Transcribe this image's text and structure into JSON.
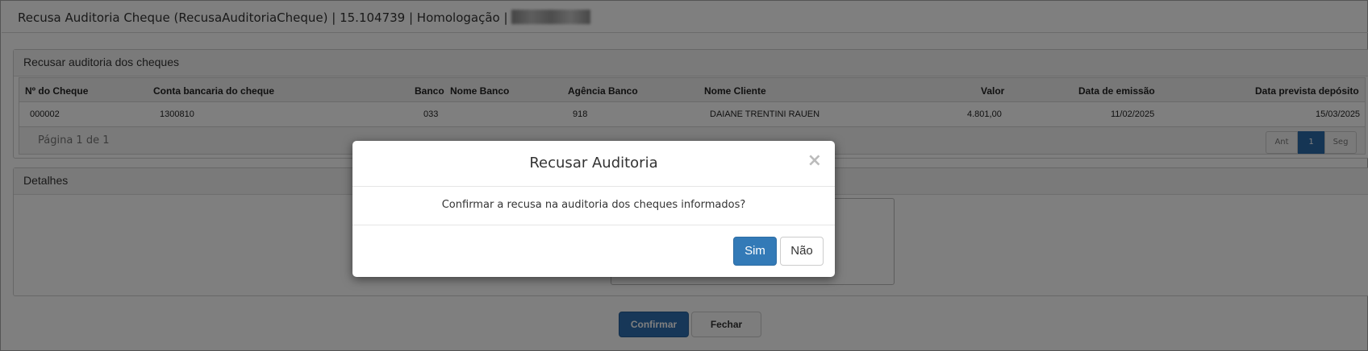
{
  "page": {
    "title": "Recusa Auditoria Cheque (RecusaAuditoriaCheque) | 15.104739 | Homologação |"
  },
  "panel_cheques": {
    "heading": "Recusar auditoria dos cheques",
    "columns": [
      "Nº do Cheque",
      "Conta bancaria do cheque",
      "Banco",
      "Nome Banco",
      "Agência Banco",
      "Nome Cliente",
      "Valor",
      "Data de emissão",
      "Data prevista depósito"
    ],
    "rows": [
      [
        "000002",
        "1300810",
        "033",
        "",
        "918",
        "DAIANE TRENTINI RAUEN",
        "4.801,00",
        "11/02/2025",
        "15/03/2025"
      ]
    ],
    "pager": {
      "info": "Página 1 de 1",
      "prev": "Ant",
      "current": "1",
      "next": "Seg"
    }
  },
  "panel_detalhes": {
    "heading": "Detalhes"
  },
  "footer": {
    "confirm_label": "Confirmar",
    "close_label": "Fechar"
  },
  "modal": {
    "title": "Recusar Auditoria",
    "close_glyph": "×",
    "message": "Confirmar a recusa na auditoria dos cheques informados?",
    "yes_label": "Sim",
    "no_label": "Não"
  },
  "colors": {
    "primary": "#337ab7",
    "overlay": "rgba(0,0,0,0.5)"
  }
}
